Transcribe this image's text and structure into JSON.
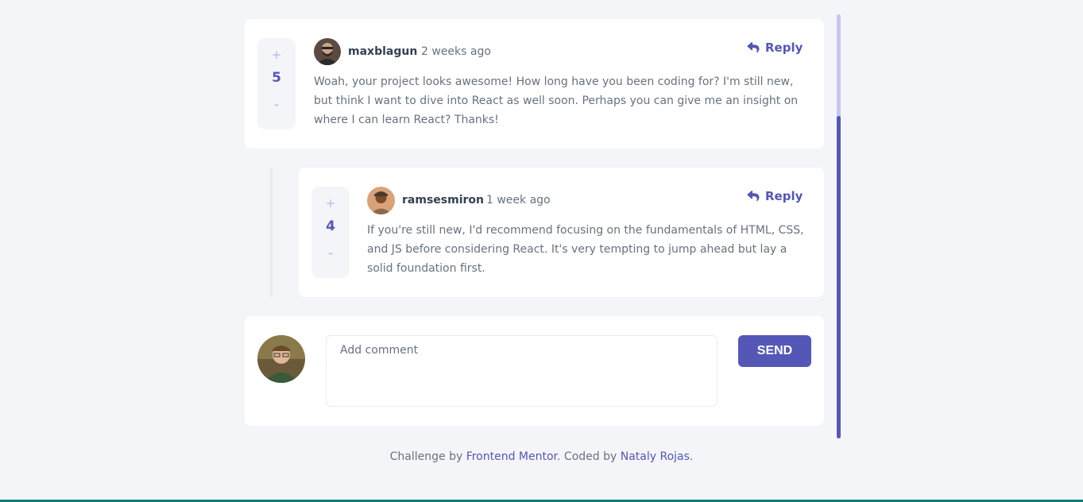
{
  "comments": [
    {
      "score": "5",
      "plus": "+",
      "minus": "-",
      "username": "maxblagun",
      "time": "2 weeks ago",
      "reply_label": "Reply",
      "content": "Woah, your project looks awesome! How long have you been coding for? I'm still new, but think I want to dive into React as well soon. Perhaps you can give me an insight on where I can learn React? Thanks!"
    }
  ],
  "replies": [
    {
      "score": "4",
      "plus": "+",
      "minus": "-",
      "username": "ramsesmiron",
      "time": "1 week ago",
      "reply_label": "Reply",
      "content": "If you're still new, I'd recommend focusing on the fundamentals of HTML, CSS, and JS before considering React. It's very tempting to jump ahead but lay a solid foundation first."
    }
  ],
  "new_comment": {
    "placeholder": "Add comment",
    "send_label": "SEND"
  },
  "footer": {
    "prefix": "Challenge by ",
    "link1": "Frontend Mentor",
    "middle": ". Coded by ",
    "link2": "Nataly Rojas",
    "suffix": "."
  },
  "colors": {
    "accent": "#5457b6",
    "accent_light": "#c5c6ef",
    "background": "#f4f5f9",
    "username": "#324152",
    "text": "#67727e"
  },
  "icons": {
    "reply": "reply-arrow-icon"
  }
}
